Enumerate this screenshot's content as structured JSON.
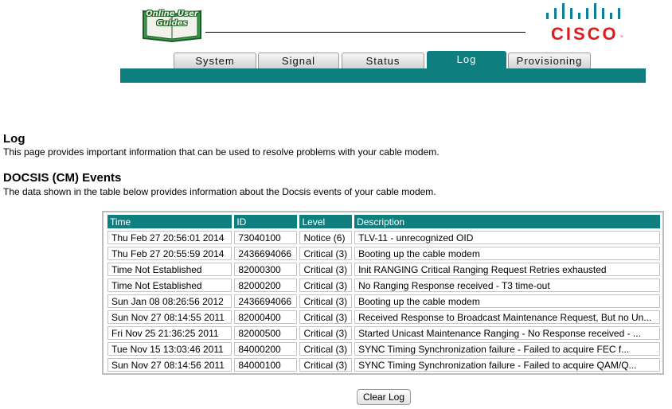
{
  "header": {
    "guide_logo_text": "Online User Guides",
    "brand": "CISCO"
  },
  "tabs": [
    {
      "label": "System",
      "active": false
    },
    {
      "label": "Signal",
      "active": false
    },
    {
      "label": "Status",
      "active": false
    },
    {
      "label": "Log",
      "active": true
    },
    {
      "label": "Provisioning",
      "active": false
    }
  ],
  "page": {
    "title": "Log",
    "intro": "This page provides important information that can be used to resolve problems with your cable modem.",
    "section_title": "DOCSIS (CM) Events",
    "section_desc": "The data shown in the table below provides information about the Docsis events of your cable modem."
  },
  "events_table": {
    "columns": [
      "Time",
      "ID",
      "Level",
      "Description"
    ],
    "rows": [
      [
        "Thu Feb 27 20:56:01 2014",
        "73040100",
        "Notice (6)",
        "TLV-11 - unrecognized OID"
      ],
      [
        "Thu Feb 27 20:55:59 2014",
        "2436694066",
        "Critical (3)",
        "Booting up the cable modem"
      ],
      [
        "Time Not Established",
        "82000300",
        "Critical (3)",
        "Init RANGING Critical Ranging Request Retries exhausted"
      ],
      [
        "Time Not Established",
        "82000200",
        "Critical (3)",
        "No Ranging Response received - T3 time-out"
      ],
      [
        "Sun Jan 08 08:26:56 2012",
        "2436694066",
        "Critical (3)",
        "Booting up the cable modem"
      ],
      [
        "Sun Nov 27 08:14:55 2011",
        "82000400",
        "Critical (3)",
        "Received Response to Broadcast Maintenance Request, But no Un..."
      ],
      [
        "Fri Nov 25 21:36:25 2011",
        "82000500",
        "Critical (3)",
        "Started Unicast Maintenance Ranging - No Response received - ..."
      ],
      [
        "Tue Nov 15 13:03:46 2011",
        "84000200",
        "Critical (3)",
        "SYNC Timing Synchronization failure - Failed to acquire FEC f..."
      ],
      [
        "Sun Nov 27 08:14:56 2011",
        "84000100",
        "Critical (3)",
        "SYNC Timing Synchronization failure - Failed to acquire QAM/Q..."
      ]
    ]
  },
  "actions": {
    "clear_log": "Clear Log"
  },
  "colors": {
    "accent_teal": "#0e7f7e",
    "cisco_red": "#e0191b"
  }
}
